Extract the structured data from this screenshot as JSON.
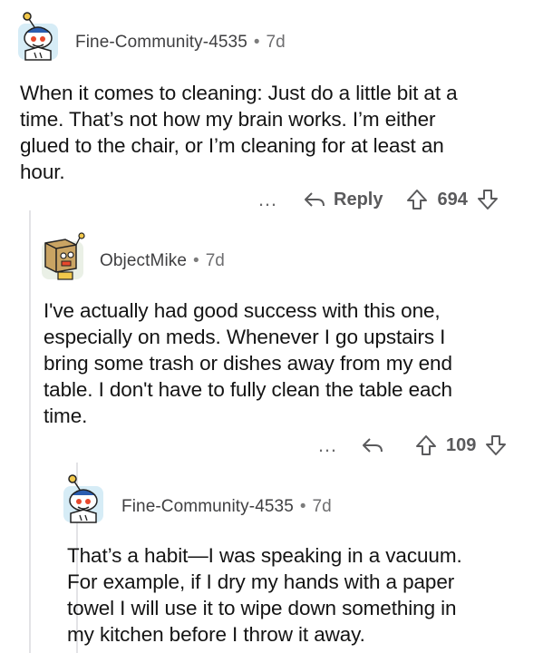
{
  "comments": [
    {
      "username": "Fine-Community-4535",
      "separator": "•",
      "age": "7d",
      "body": "When it comes to cleaning: Just do a little bit at a\ntime. That’s not how my brain works. I’m either\nglued to the chair, or I’m cleaning for at least an\nhour.",
      "more_label": "…",
      "reply_label": "Reply",
      "score": "694",
      "avatar_icon": "snoo-avatar-icon"
    },
    {
      "username": "ObjectMike",
      "separator": "•",
      "age": "7d",
      "body": "I've actually had good success with this one,\nespecially on meds. Whenever I go upstairs I\nbring some trash or dishes away from my end\ntable. I don't have to fully clean the table each\ntime.",
      "more_label": "…",
      "reply_label": "",
      "score": "109",
      "avatar_icon": "box-robot-avatar-icon"
    },
    {
      "username": "Fine-Community-4535",
      "separator": "•",
      "age": "7d",
      "body": "That’s a habit—I was speaking in a vacuum.\nFor example, if I dry my hands with a paper\ntowel I will use it to wipe down something in\nmy kitchen before I throw it away.",
      "avatar_icon": "snoo-avatar-icon"
    }
  ],
  "colors": {
    "thread_line": "#e3e3e6",
    "meta_text": "#6e6e70",
    "action_text": "#5a5a5c",
    "avatar_bg": "#d9eef7",
    "snoo_blue": "#2a5db0"
  }
}
